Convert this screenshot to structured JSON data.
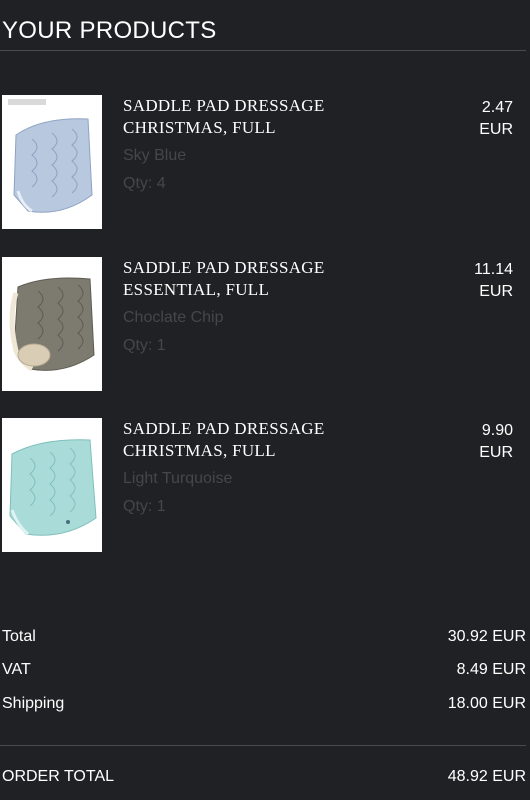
{
  "header": {
    "title": "YOUR PRODUCTS"
  },
  "items": [
    {
      "name": "SADDLE PAD DRESSAGE CHRISTMAS, FULL",
      "variant": "Sky Blue",
      "qty": "Qty: 4",
      "price_amount": "2.47",
      "currency": "EUR",
      "color": "#b7c8df"
    },
    {
      "name": "SADDLE PAD DRESSAGE ESSENTIAL, FULL",
      "variant": "Choclate Chip",
      "qty": "Qty: 1",
      "price_amount": "11.14",
      "currency": "EUR",
      "color": "#7d7a6f"
    },
    {
      "name": "SADDLE PAD DRESSAGE CHRISTMAS, FULL",
      "variant": "Light Turquoise",
      "qty": "Qty: 1",
      "price_amount": "9.90",
      "currency": "EUR",
      "color": "#a9dcd9"
    }
  ],
  "summary": {
    "total_label": "Total",
    "total_value": "30.92 EUR",
    "vat_label": "VAT",
    "vat_value": "8.49 EUR",
    "shipping_label": "Shipping",
    "shipping_value": "18.00 EUR",
    "order_total_label": "ORDER TOTAL",
    "order_total_value": "48.92 EUR"
  },
  "colors": {
    "background": "#202124",
    "muted_text": "#44474a",
    "divider": "#4a4b4e"
  }
}
